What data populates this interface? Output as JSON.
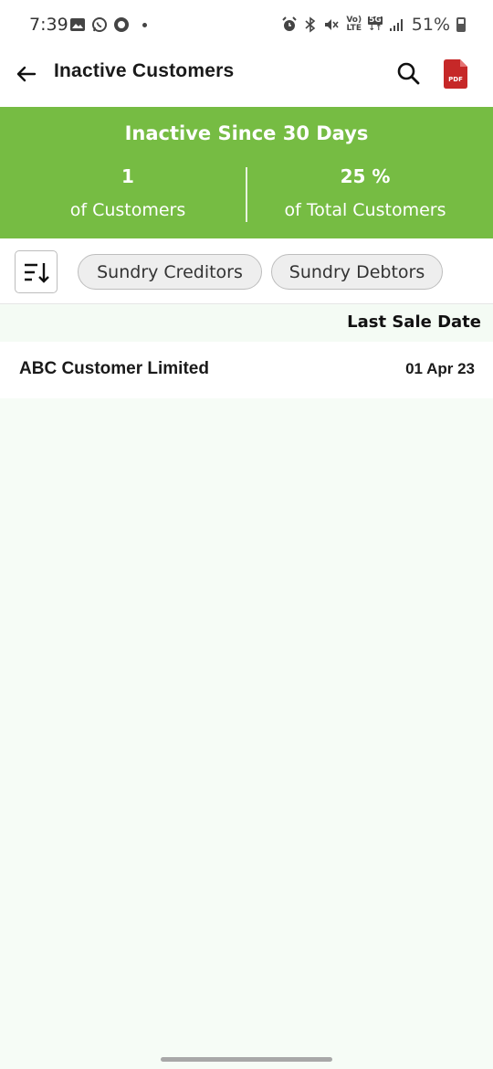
{
  "status_bar": {
    "time": "7:39",
    "lte_top": "Vo)",
    "lte_bottom": "LTE",
    "net_top": "5G",
    "net_bottom": "↓↑",
    "battery": "51%",
    "icons_left": [
      "gallery-icon",
      "whatsapp-icon",
      "record-icon",
      "notification-dot"
    ],
    "icons_right": [
      "alarm-icon",
      "bluetooth-icon",
      "mute-icon",
      "volte-icon",
      "5g-icon",
      "signal-icon",
      "battery-icon"
    ]
  },
  "app_bar": {
    "title": "Inactive Customers",
    "pdf_label": "PDF"
  },
  "summary": {
    "title": "Inactive Since 30 Days",
    "left_value": "1",
    "left_label": "of Customers",
    "right_value": "25 %",
    "right_label": "of Total Customers",
    "color": "#76bc43"
  },
  "filters": {
    "chips": [
      "Sundry Creditors",
      "Sundry Debtors"
    ]
  },
  "table": {
    "column_header": "Last Sale Date",
    "rows": [
      {
        "name": "ABC Customer Limited",
        "date": "01 Apr 23"
      }
    ]
  }
}
